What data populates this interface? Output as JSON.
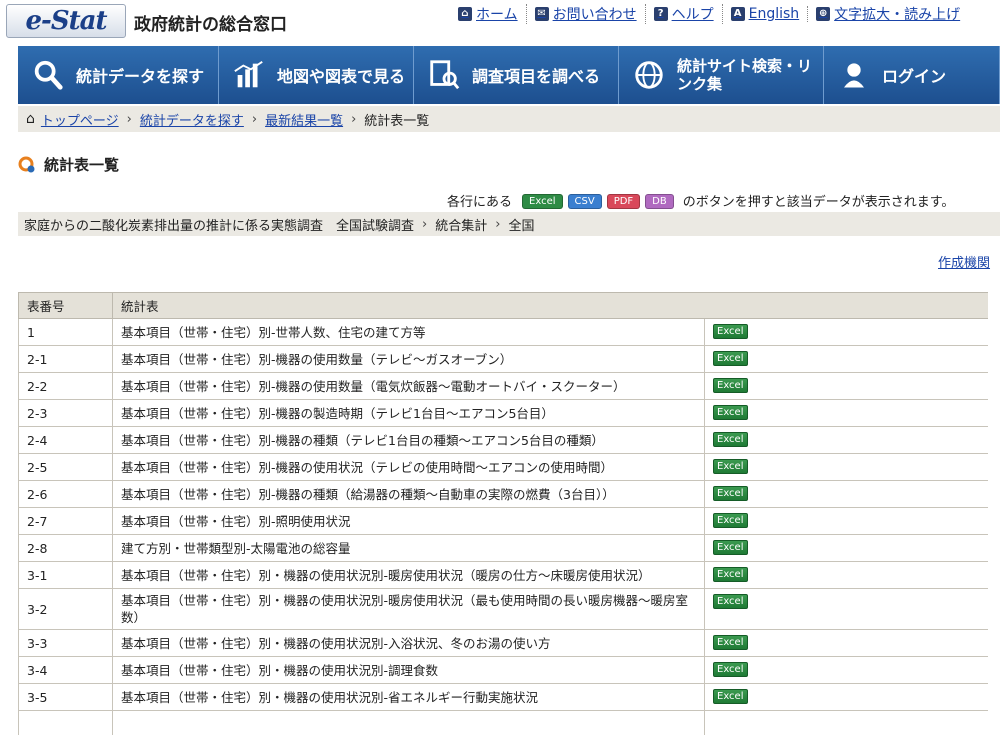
{
  "header": {
    "logo_text": "e-Stat",
    "site_title": "政府統計の総合窓口",
    "links": [
      {
        "icon": "home-icon",
        "glyph": "⌂",
        "label": "ホーム"
      },
      {
        "icon": "contact-icon",
        "glyph": "✉",
        "label": "お問い合わせ"
      },
      {
        "icon": "help-icon",
        "glyph": "?",
        "label": "ヘルプ"
      },
      {
        "icon": "english-icon",
        "glyph": "A",
        "label": "English"
      },
      {
        "icon": "zoom-icon",
        "glyph": "⊕",
        "label": "文字拡大・読み上げ"
      }
    ]
  },
  "nav": [
    {
      "icon": "search-icon",
      "label": "統計データを探す"
    },
    {
      "icon": "map-chart-icon",
      "label": "地図や図表で見る"
    },
    {
      "icon": "document-search-icon",
      "label": "調査項目を調べる"
    },
    {
      "icon": "globe-icon",
      "label": "統計サイト検索・リンク集"
    },
    {
      "icon": "user-icon",
      "label": "ログイン"
    }
  ],
  "breadcrumb": {
    "items": [
      "トップページ",
      "統計データを探す",
      "最新結果一覧"
    ],
    "current": "統計表一覧"
  },
  "page_title": "統計表一覧",
  "info": {
    "prefix": "各行にある",
    "buttons": [
      {
        "label": "Excel",
        "color": "#2e8b45"
      },
      {
        "label": "CSV",
        "color": "#3a7fd0"
      },
      {
        "label": "PDF",
        "color": "#d9485a"
      },
      {
        "label": "DB",
        "color": "#b06ac0"
      }
    ],
    "suffix": "のボタンを押すと該当データが表示されます。"
  },
  "survey_path": {
    "survey": "家庭からの二酸化炭素排出量の推計に係る実態調査　全国試験調査",
    "level1": "統合集計",
    "level2": "全国"
  },
  "creator_link": "作成機関",
  "table": {
    "headers": [
      "表番号",
      "統計表"
    ],
    "button_label": "Excel",
    "rows": [
      {
        "id": "1",
        "title": "基本項目（世帯・住宅）別-世帯人数、住宅の建て方等"
      },
      {
        "id": "2-1",
        "title": "基本項目（世帯・住宅）別-機器の使用数量（テレビ～ガスオーブン）"
      },
      {
        "id": "2-2",
        "title": "基本項目（世帯・住宅）別-機器の使用数量（電気炊飯器～電動オートバイ・スクーター）"
      },
      {
        "id": "2-3",
        "title": "基本項目（世帯・住宅）別-機器の製造時期（テレビ1台目～エアコン5台目）"
      },
      {
        "id": "2-4",
        "title": "基本項目（世帯・住宅）別-機器の種類（テレビ1台目の種類～エアコン5台目の種類）"
      },
      {
        "id": "2-5",
        "title": "基本項目（世帯・住宅）別-機器の使用状況（テレビの使用時間～エアコンの使用時間）"
      },
      {
        "id": "2-6",
        "title": "基本項目（世帯・住宅）別-機器の種類（給湯器の種類～自動車の実際の燃費（3台目））"
      },
      {
        "id": "2-7",
        "title": "基本項目（世帯・住宅）別-照明使用状況"
      },
      {
        "id": "2-8",
        "title": "建て方別・世帯類型別-太陽電池の総容量"
      },
      {
        "id": "3-1",
        "title": "基本項目（世帯・住宅）別・機器の使用状況別-暖房使用状況（暖房の仕方～床暖房使用状況）"
      },
      {
        "id": "3-2",
        "title": "基本項目（世帯・住宅）別・機器の使用状況別-暖房使用状況（最も使用時間の長い暖房機器～暖房室数）"
      },
      {
        "id": "3-3",
        "title": "基本項目（世帯・住宅）別・機器の使用状況別-入浴状況、冬のお湯の使い方"
      },
      {
        "id": "3-4",
        "title": "基本項目（世帯・住宅）別・機器の使用状況別-調理食数"
      },
      {
        "id": "3-5",
        "title": "基本項目（世帯・住宅）別・機器の使用状況別-省エネルギー行動実施状況"
      },
      {
        "id": "",
        "title": ""
      }
    ]
  }
}
